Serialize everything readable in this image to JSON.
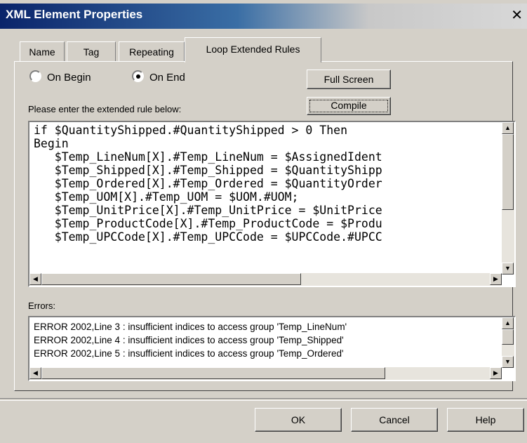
{
  "window": {
    "title": "XML Element Properties",
    "close_glyph": "✕"
  },
  "tabs": [
    {
      "label": "Name"
    },
    {
      "label": "Tag"
    },
    {
      "label": "Repeating"
    },
    {
      "label": "Loop Extended Rules"
    }
  ],
  "options": {
    "on_begin": "On Begin",
    "on_end": "On End",
    "selected": "On End"
  },
  "buttons": {
    "full_screen": "Full Screen",
    "compile": "Compile",
    "ok": "OK",
    "cancel": "Cancel",
    "help": "Help"
  },
  "rule": {
    "prompt": "Please enter the extended rule below:",
    "lines": [
      "if $QuantityShipped.#QuantityShipped > 0 Then",
      "Begin",
      "   $Temp_LineNum[X].#Temp_LineNum = $AssignedIdent",
      "   $Temp_Shipped[X].#Temp_Shipped = $QuantityShipp",
      "   $Temp_Ordered[X].#Temp_Ordered = $QuantityOrder",
      "   $Temp_UOM[X].#Temp_UOM = $UOM.#UOM;",
      "   $Temp_UnitPrice[X].#Temp_UnitPrice = $UnitPrice",
      "   $Temp_ProductCode[X].#Temp_ProductCode = $Produ",
      "   $Temp_UPCCode[X].#Temp_UPCCode = $UPCCode.#UPCC"
    ]
  },
  "errors": {
    "label": "Errors:",
    "lines": [
      "ERROR 2002,Line 3 : insufficient indices to access group 'Temp_LineNum'",
      "ERROR 2002,Line 4 : insufficient indices to access group 'Temp_Shipped'",
      "ERROR 2002,Line 5 : insufficient indices to access group 'Temp_Ordered'"
    ]
  },
  "icons": {
    "up": "up-arrow-icon",
    "down": "down-arrow-icon",
    "left": "left-arrow-icon",
    "right": "right-arrow-icon"
  }
}
